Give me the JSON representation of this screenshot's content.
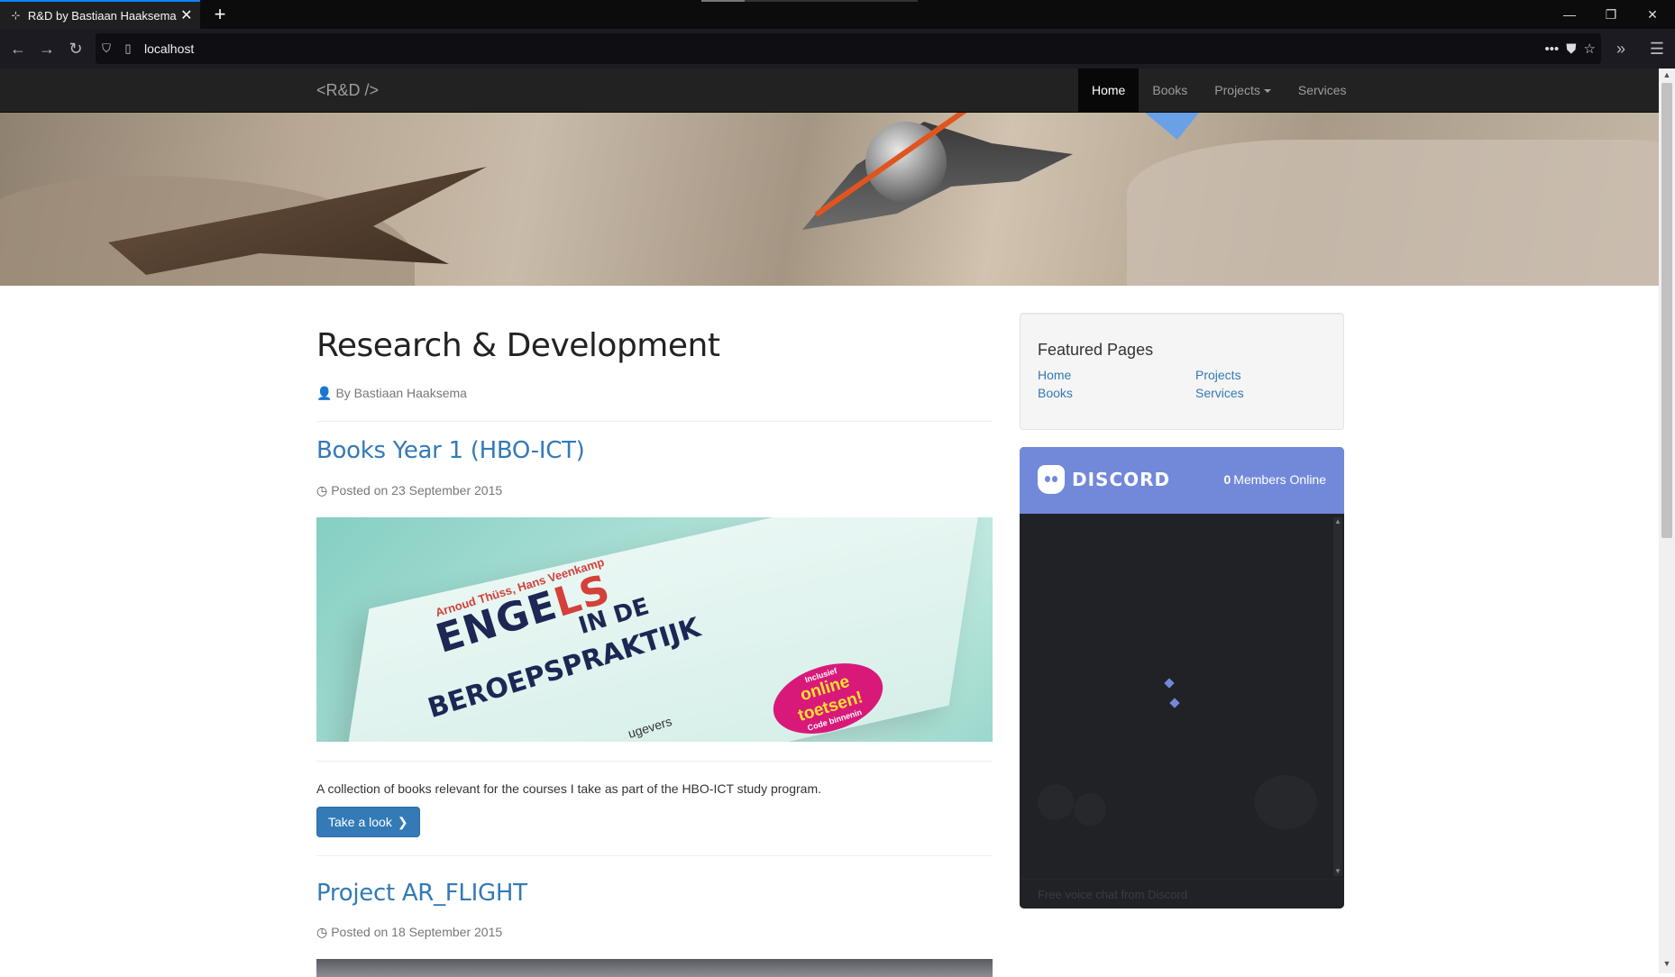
{
  "browser": {
    "tab_title": "R&D by Bastiaan Haaksema",
    "tab_close": "✕",
    "new_tab": "+",
    "url": "localhost",
    "controls": {
      "minimize": "—",
      "maximize": "❐",
      "close": "✕"
    }
  },
  "site": {
    "brand": "<R&D />",
    "menu": [
      {
        "label": "Home",
        "active": true
      },
      {
        "label": "Books",
        "active": false
      },
      {
        "label": "Projects",
        "dropdown": true
      },
      {
        "label": "Services",
        "active": false
      }
    ]
  },
  "main": {
    "title": "Research & Development",
    "author": "By Bastiaan Haaksema",
    "posts": [
      {
        "title": "Books Year 1 (HBO-ICT)",
        "date": "Posted on 23 September 2015",
        "image": {
          "author": "Arnoud Thüss, Hans Veenkamp",
          "title_line1_a": "ENGE",
          "title_line1_b": "LS",
          "title_line2": "IN DE",
          "title_line3": "BEROEPSPRAKTIJK",
          "badge_top": "Inclusief",
          "badge_mid1": "online",
          "badge_mid2": "toetsen!",
          "badge_bottom": "Code binnenin",
          "publisher": "ugevers"
        },
        "description": "A collection of books relevant for the courses I take as part of the HBO-ICT study program.",
        "button": "Take a look"
      },
      {
        "title": "Project AR_FLIGHT",
        "date": "Posted on 18 September 2015"
      }
    ]
  },
  "sidebar": {
    "featured": {
      "heading": "Featured Pages",
      "links": [
        "Home",
        "Books",
        "Projects",
        "Services"
      ]
    },
    "discord": {
      "brand": "DISCORD",
      "members_count": "0",
      "members_label": "Members Online",
      "footer": "Free voice chat from Discord"
    }
  }
}
